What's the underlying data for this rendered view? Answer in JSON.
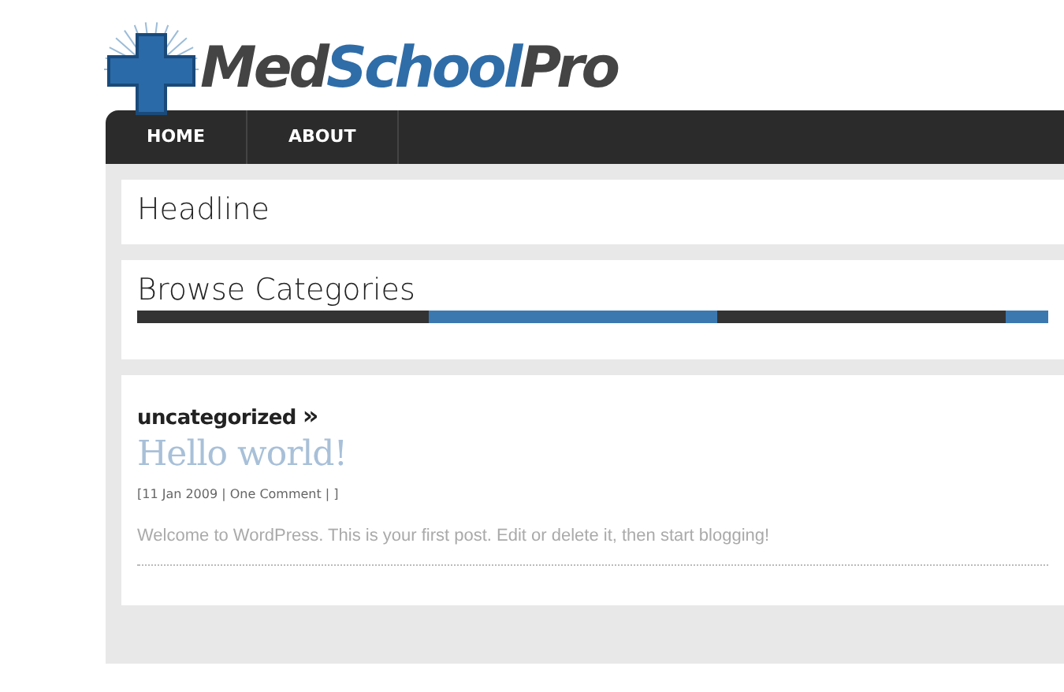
{
  "logo": {
    "parts": [
      {
        "text": "Med",
        "kind": "dark"
      },
      {
        "text": "School",
        "kind": "accent"
      },
      {
        "text": "Pro",
        "kind": "dark"
      }
    ]
  },
  "nav": {
    "items": [
      {
        "label": "HOME",
        "selected": false
      },
      {
        "label": "ABOUT",
        "selected": false
      }
    ]
  },
  "headline": {
    "title": "Headline"
  },
  "categories": {
    "title": "Browse Categories"
  },
  "post": {
    "category": "uncategorized",
    "category_arrow": "»",
    "title": "Hello world!",
    "meta": "[11 Jan 2009 | One Comment | ]",
    "excerpt": "Welcome to WordPress. This is your first post. Edit or delete it, then start blogging!"
  }
}
